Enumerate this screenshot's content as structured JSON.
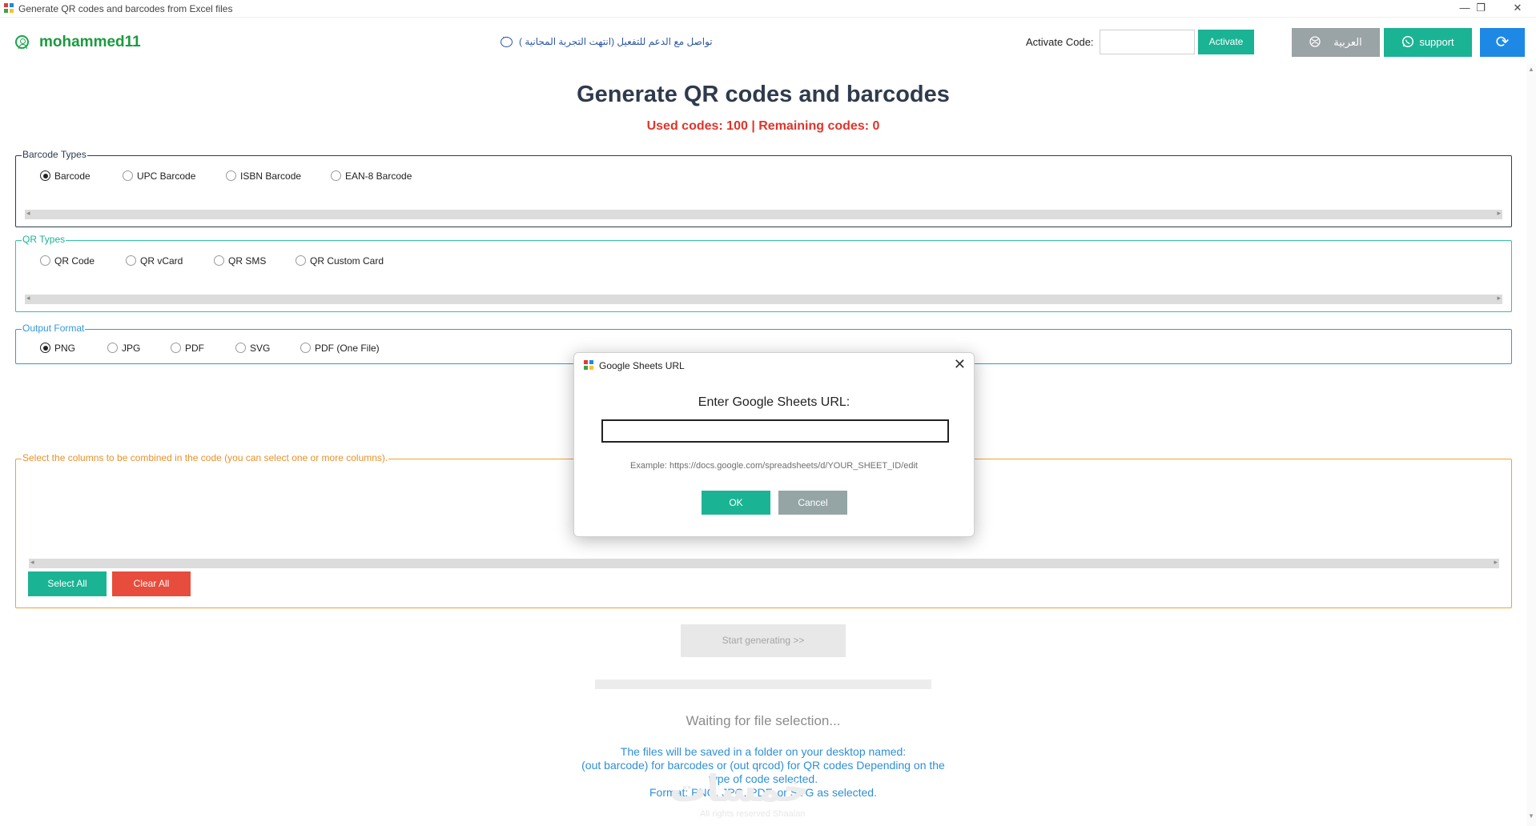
{
  "window": {
    "title": "Generate QR codes and barcodes from Excel files",
    "minimize_glyph": "—",
    "restore_glyph": "❐",
    "close_glyph": "✕"
  },
  "header": {
    "username": "mohammed11",
    "support_message": "تواصل مع الدعم للتفعيل (انتهت التجربة المجانية )",
    "activate_label": "Activate Code:",
    "activate_value": "",
    "activate_button": "Activate",
    "language_button": "العربية",
    "support_button": "support",
    "refresh_glyph": "⟳"
  },
  "main": {
    "title": "Generate QR codes and barcodes",
    "codes_status": "Used codes: 100 | Remaining codes: 0"
  },
  "barcode_types": {
    "legend": "Barcode Types",
    "options": [
      "Barcode",
      "UPC Barcode",
      "ISBN Barcode",
      "EAN-8 Barcode"
    ],
    "selected": "Barcode"
  },
  "qr_types": {
    "legend": "QR Types",
    "options": [
      "QR Code",
      "QR vCard",
      "QR SMS",
      "QR Custom Card"
    ],
    "selected": ""
  },
  "output_format": {
    "legend": "Output Format",
    "options": [
      "PNG",
      "JPG",
      "PDF",
      "SVG",
      "PDF (One File)"
    ],
    "selected": "PNG"
  },
  "columns": {
    "legend": "Select the columns to be combined in the code (you can select one or more columns).",
    "select_all": "Select All",
    "clear_all": "Clear All"
  },
  "generate": {
    "start_button": "Start generating >>",
    "progress": 0,
    "status": "Waiting for file selection...",
    "info_lines": [
      "The files will be saved in a folder on your desktop named:",
      "(out barcode) for barcodes or (out qrcod) for QR codes Depending on the",
      "type of code selected.",
      "Format: PNG, JPG, PDF, or SVG as selected."
    ],
    "watermark": "خمسات",
    "watermark_sub": "All rights reserved Shaalan"
  },
  "dialog": {
    "title": "Google Sheets URL",
    "prompt": "Enter Google Sheets URL:",
    "url_value": "",
    "example": "Example: https://docs.google.com/spreadsheets/d/YOUR_SHEET_ID/edit",
    "ok": "OK",
    "cancel": "Cancel",
    "close_glyph": "✕"
  },
  "colors": {
    "accent_green": "#1ab394",
    "danger_red": "#e74c3c",
    "brand_blue": "#1e88e5",
    "status_red": "#e0342b",
    "username_green": "#1a9b3f"
  }
}
